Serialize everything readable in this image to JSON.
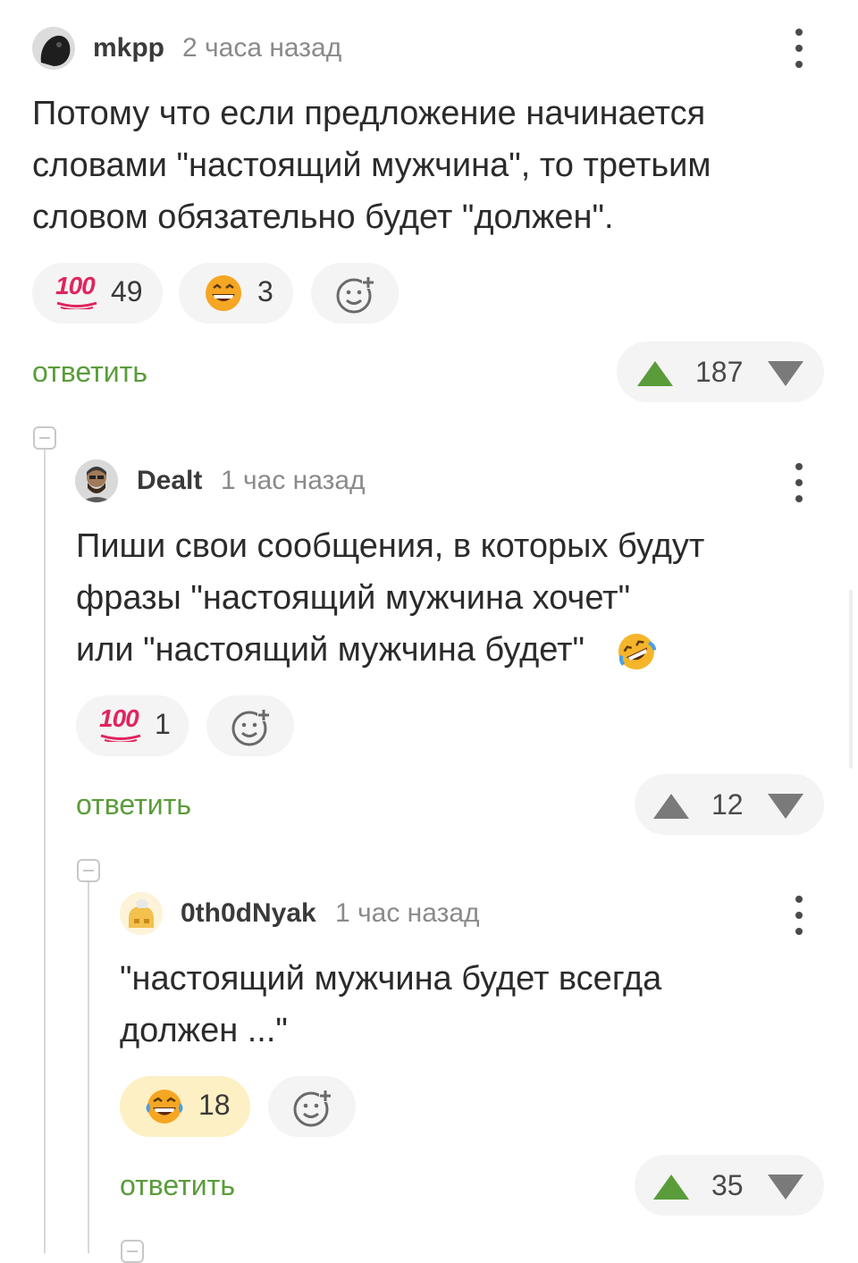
{
  "comments": [
    {
      "author": "mkpp",
      "time": "2 часа назад",
      "lines": [
        "Потому что если предложение начинается",
        "словами \"настоящий мужчина\", то третьим",
        "словом обязательно будет \"должен\"."
      ],
      "reactions": [
        {
          "icon": "hundred-points-icon",
          "count": "49"
        },
        {
          "icon": "grinning-face-icon",
          "count": "3"
        }
      ],
      "reply_label": "ответить",
      "rating": "187",
      "upvote_color": "#5a9c3a"
    },
    {
      "author": "Dealt",
      "time": "1 час назад",
      "lines": [
        "Пиши свои сообщения, в которых будут",
        "фразы \"настоящий мужчина хочет\"",
        "или \"настоящий мужчина будет\""
      ],
      "reactions": [
        {
          "icon": "hundred-points-icon",
          "count": "1"
        }
      ],
      "reply_label": "ответить",
      "rating": "12",
      "upvote_color": "#7a7a7a"
    },
    {
      "author": "0th0dNyak",
      "time": "1 час назад",
      "lines": [
        "\"настоящий мужчина будет всегда",
        "должен ...\""
      ],
      "reactions": [
        {
          "icon": "tears-of-joy-icon",
          "count": "18",
          "active": true
        }
      ],
      "reply_label": "ответить",
      "rating": "35",
      "upvote_color": "#5a9c3a"
    }
  ],
  "colors": {
    "accent": "#5a9c3a",
    "pill_bg": "#f4f4f4",
    "active_pill_bg": "#fdf0c4",
    "text": "#2b2b2b",
    "muted": "#8a8a8a"
  }
}
